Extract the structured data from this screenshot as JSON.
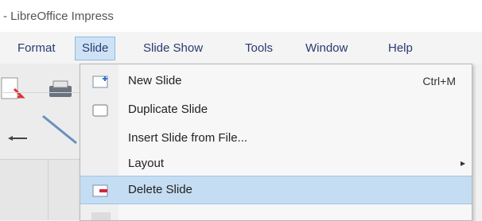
{
  "window": {
    "title": "- LibreOffice Impress"
  },
  "menubar": {
    "items": [
      {
        "label": "Format"
      },
      {
        "label": "Slide"
      },
      {
        "label": "Slide Show"
      },
      {
        "label": "Tools"
      },
      {
        "label": "Window"
      },
      {
        "label": "Help"
      }
    ],
    "active_index": 1
  },
  "slide_menu": {
    "items": [
      {
        "label": "New Slide",
        "shortcut": "Ctrl+M",
        "icon": "new-slide-icon"
      },
      {
        "label": "Duplicate Slide",
        "icon": "duplicate-slide-icon"
      },
      {
        "label": "Insert Slide from File..."
      },
      {
        "label": "Layout",
        "submenu": true
      },
      {
        "label": "Delete Slide",
        "icon": "delete-slide-icon",
        "highlighted": true
      }
    ]
  },
  "colors": {
    "menu_highlight": "#c5ddf2",
    "menubar_active": "#cde3f5",
    "menu_text": "#2a3a70"
  }
}
